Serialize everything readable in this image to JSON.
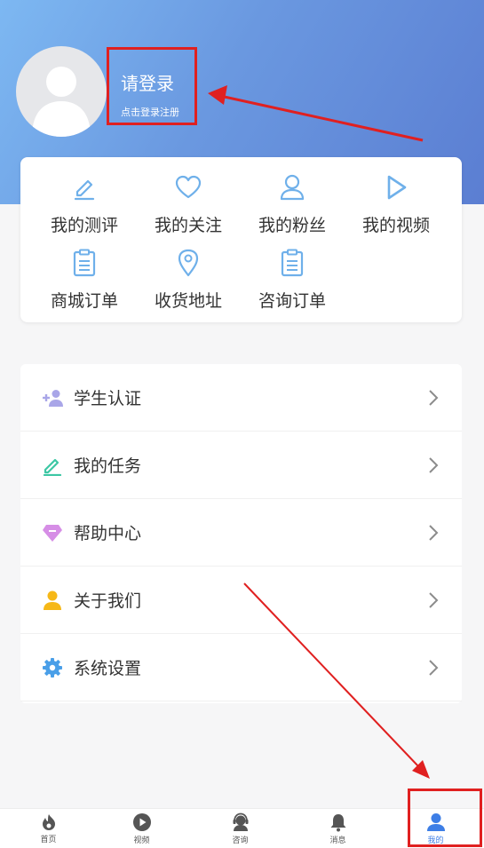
{
  "profile": {
    "login_title": "请登录",
    "login_subtitle": "点击登录注册"
  },
  "quick_menu": [
    {
      "label": "我的测评",
      "icon": "pencil-icon"
    },
    {
      "label": "我的关注",
      "icon": "heart-icon"
    },
    {
      "label": "我的粉丝",
      "icon": "user-icon"
    },
    {
      "label": "我的视频",
      "icon": "play-icon"
    },
    {
      "label": "商城订单",
      "icon": "clipboard-icon"
    },
    {
      "label": "收货地址",
      "icon": "location-pin-icon"
    },
    {
      "label": "咨询订单",
      "icon": "clipboard-icon"
    }
  ],
  "list_menu": [
    {
      "label": "学生认证",
      "icon": "add-user-icon",
      "color": "#a9a6e8"
    },
    {
      "label": "我的任务",
      "icon": "pencil-icon",
      "color": "#3cc7a4"
    },
    {
      "label": "帮助中心",
      "icon": "diamond-icon",
      "color": "#d68ee6"
    },
    {
      "label": "关于我们",
      "icon": "person-icon",
      "color": "#f6b817"
    },
    {
      "label": "系统设置",
      "icon": "gear-icon",
      "color": "#4a9fe8"
    }
  ],
  "tabbar": [
    {
      "label": "首页",
      "icon": "flame-icon"
    },
    {
      "label": "视频",
      "icon": "play-circle-icon"
    },
    {
      "label": "咨询",
      "icon": "headset-icon"
    },
    {
      "label": "消息",
      "icon": "bell-icon"
    },
    {
      "label": "我的",
      "icon": "person-icon",
      "active": true
    }
  ],
  "colors": {
    "accent": "#3d7ee6",
    "icon_blue": "#6fb0ea",
    "annotation_red": "#e02020"
  }
}
